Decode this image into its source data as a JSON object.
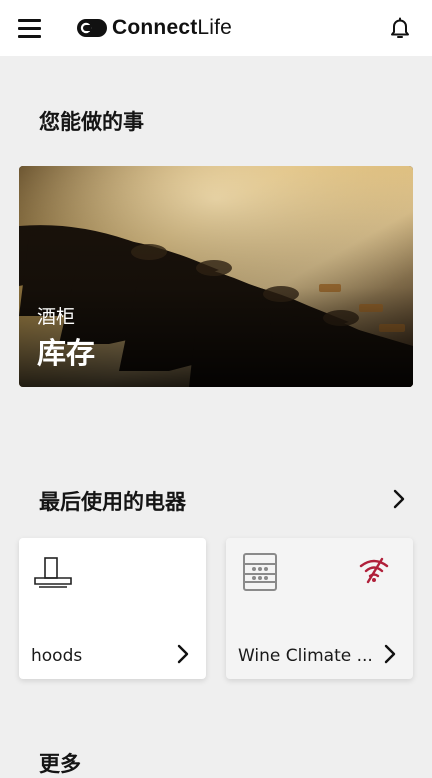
{
  "header": {
    "logo_bold": "Connect",
    "logo_light": "Life"
  },
  "section_things": {
    "title": "您能做的事",
    "hero": {
      "subtitle": "酒柜",
      "title": "库存"
    }
  },
  "section_recent": {
    "title": "最后使用的电器",
    "devices": [
      {
        "name": "hoods",
        "icon": "range-hood-icon"
      },
      {
        "name": "Wine Climate ...",
        "icon": "wine-cabinet-icon",
        "status_icon": "wifi-off-icon"
      }
    ]
  },
  "section_more": {
    "title": "更多"
  },
  "colors": {
    "background": "#efefef",
    "header_bg": "#ffffff",
    "offline_red": "#b0203a",
    "icon_gray": "#8a8a8a"
  }
}
